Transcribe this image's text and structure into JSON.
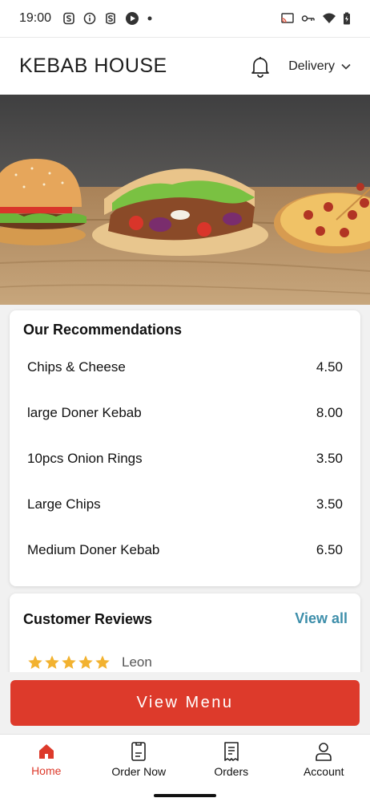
{
  "status_bar": {
    "time": "19:00"
  },
  "header": {
    "title": "KEBAB HOUSE",
    "mode_label": "Delivery"
  },
  "recommendations": {
    "title": "Our Recommendations",
    "items": [
      {
        "name": "Chips & Cheese",
        "price": "4.50"
      },
      {
        "name": "large Doner Kebab",
        "price": "8.00"
      },
      {
        "name": "10pcs Onion Rings",
        "price": "3.50"
      },
      {
        "name": "Large Chips",
        "price": "3.50"
      },
      {
        "name": "Medium Doner Kebab",
        "price": "6.50"
      }
    ]
  },
  "reviews": {
    "title": "Customer Reviews",
    "view_all_label": "View all",
    "items": [
      {
        "rating": 5,
        "max_rating": 5,
        "name": "Leon"
      }
    ]
  },
  "cta": {
    "label": "View Menu"
  },
  "bottom_nav": {
    "items": [
      {
        "label": "Home",
        "icon": "home-icon",
        "active": true
      },
      {
        "label": "Order Now",
        "icon": "order-icon",
        "active": false
      },
      {
        "label": "Orders",
        "icon": "receipt-icon",
        "active": false
      },
      {
        "label": "Account",
        "icon": "user-icon",
        "active": false
      }
    ]
  },
  "colors": {
    "accent": "#dd3a2b",
    "link": "#3d8eaa",
    "star": "#f2b230"
  }
}
